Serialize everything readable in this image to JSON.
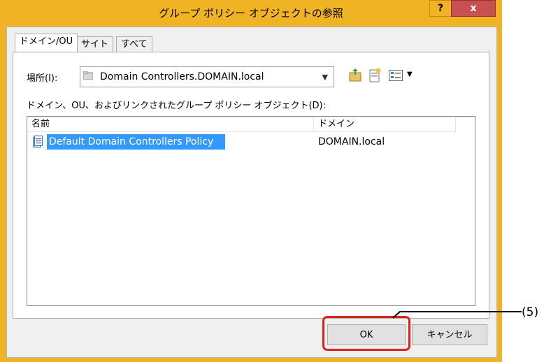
{
  "window": {
    "title": "グループ ポリシー オブジェクトの参照",
    "help_label": "?",
    "close_label": "x"
  },
  "tabs": [
    {
      "label": "ドメイン/OU",
      "active": true
    },
    {
      "label": "サイト",
      "active": false
    },
    {
      "label": "すべて",
      "active": false
    }
  ],
  "location": {
    "label": "場所(I):",
    "value": "Domain Controllers.DOMAIN.local"
  },
  "list_label": "ドメイン、OU、およびリンクされたグループ ポリシー オブジェクト(D):",
  "list": {
    "columns": [
      "名前",
      "ドメイン"
    ],
    "rows": [
      {
        "name": "Default Domain Controllers Policy",
        "domain": "DOMAIN.local",
        "selected": true
      }
    ]
  },
  "buttons": {
    "ok": "OK",
    "cancel": "キャンセル"
  },
  "annotation": {
    "callout": "(5)",
    "highlight_color": "#d9221b"
  },
  "colors": {
    "frame": "#f0b323",
    "close": "#c75050",
    "selection": "#3399ff"
  }
}
